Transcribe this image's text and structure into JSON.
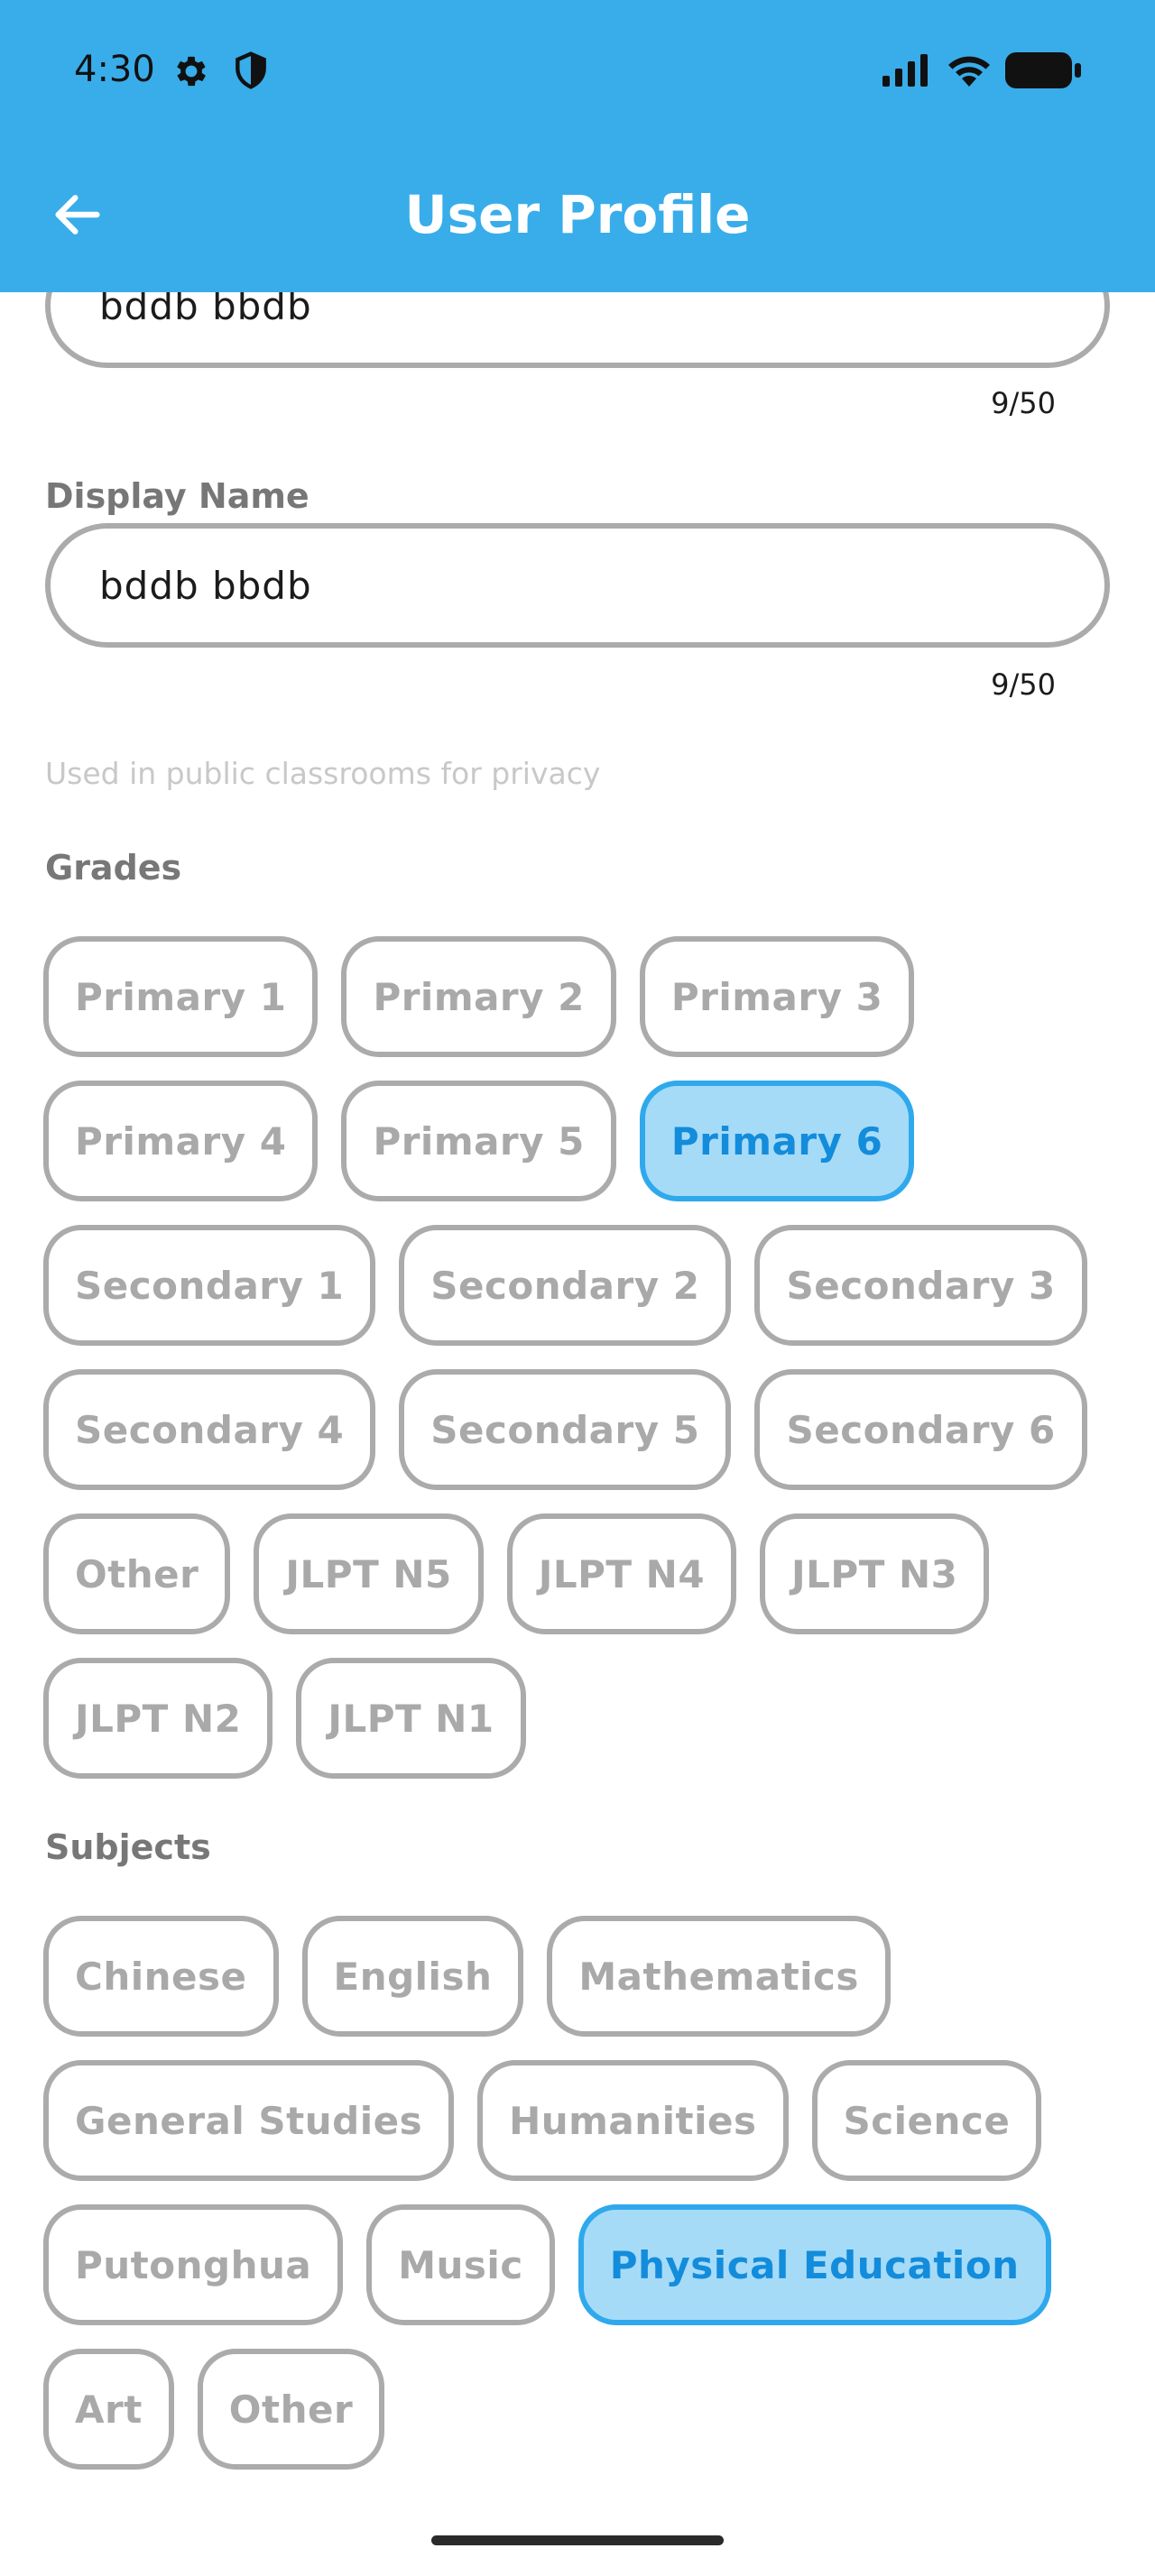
{
  "status_bar": {
    "time": "4:30",
    "left_icons": [
      "gear-icon",
      "shield-icon"
    ],
    "right_icons": [
      "cellular-signal-icon",
      "wifi-icon",
      "battery-icon"
    ]
  },
  "header": {
    "title": "User Profile",
    "back_icon": "arrow-left-icon",
    "background": "#38ADEA"
  },
  "name_field": {
    "value": "bddb bbdb",
    "counter": "9/50"
  },
  "display_name": {
    "label": "Display Name",
    "value": "bddb bbdb",
    "counter": "9/50",
    "helper": "Used in public classrooms for privacy"
  },
  "grades": {
    "label": "Grades",
    "options": [
      {
        "label": "Primary 1",
        "selected": false
      },
      {
        "label": "Primary 2",
        "selected": false
      },
      {
        "label": "Primary 3",
        "selected": false
      },
      {
        "label": "Primary 4",
        "selected": false
      },
      {
        "label": "Primary 5",
        "selected": false
      },
      {
        "label": "Primary 6",
        "selected": true
      },
      {
        "label": "Secondary 1",
        "selected": false
      },
      {
        "label": "Secondary 2",
        "selected": false
      },
      {
        "label": "Secondary 3",
        "selected": false
      },
      {
        "label": "Secondary 4",
        "selected": false
      },
      {
        "label": "Secondary 5",
        "selected": false
      },
      {
        "label": "Secondary 6",
        "selected": false
      },
      {
        "label": "Other",
        "selected": false
      },
      {
        "label": "JLPT N5",
        "selected": false
      },
      {
        "label": "JLPT N4",
        "selected": false
      },
      {
        "label": "JLPT N3",
        "selected": false
      },
      {
        "label": "JLPT N2",
        "selected": false
      },
      {
        "label": "JLPT N1",
        "selected": false
      }
    ]
  },
  "subjects": {
    "label": "Subjects",
    "options": [
      {
        "label": "Chinese",
        "selected": false
      },
      {
        "label": "English",
        "selected": false
      },
      {
        "label": "Mathematics",
        "selected": false
      },
      {
        "label": "General Studies",
        "selected": false
      },
      {
        "label": "Humanities",
        "selected": false
      },
      {
        "label": "Science",
        "selected": false
      },
      {
        "label": "Putonghua",
        "selected": false
      },
      {
        "label": "Music",
        "selected": false
      },
      {
        "label": "Physical Education",
        "selected": true
      },
      {
        "label": "Art",
        "selected": false
      },
      {
        "label": "Other",
        "selected": false
      }
    ]
  },
  "colors": {
    "accent": "#38ADEA",
    "chip_selected_bg": "#A6DBF8",
    "chip_selected_text": "#138CDB",
    "chip_border": "#ABABAB"
  }
}
